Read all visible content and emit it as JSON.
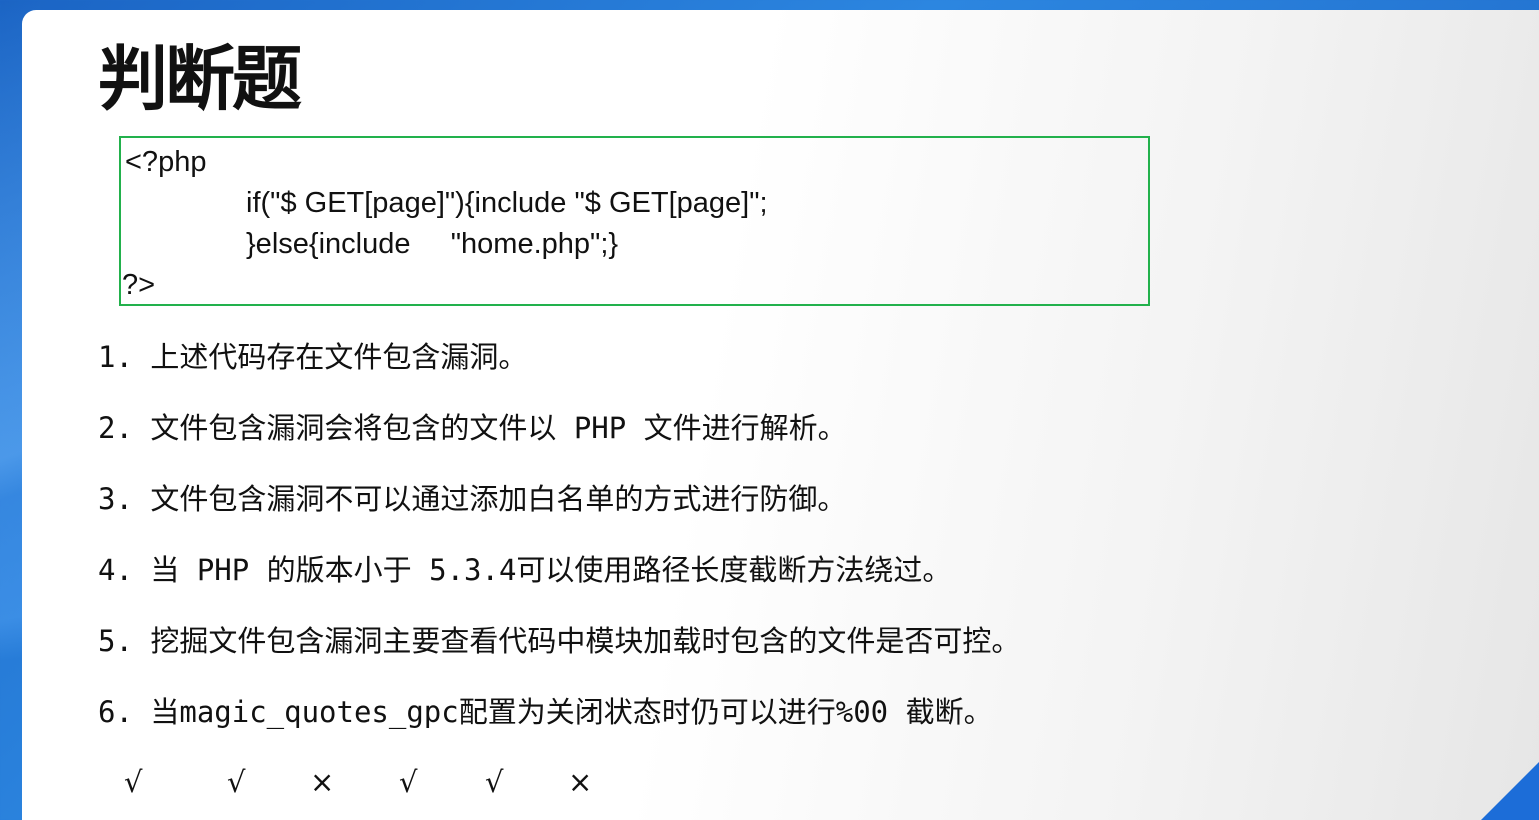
{
  "slide": {
    "title": "判断题",
    "code": {
      "line1": "<?php",
      "line2": "if(\"$ GET[page]\"){include \"$ GET[page]\";",
      "line3": "}else{include     \"home.php\";}",
      "line4": "?>"
    },
    "questions": [
      "1. 上述代码存在文件包含漏洞。",
      "2. 文件包含漏洞会将包含的文件以 PHP 文件进行解析。",
      "3. 文件包含漏洞不可以通过添加白名单的方式进行防御。",
      "4. 当 PHP 的版本小于 5.3.4可以使用路径长度截断方法绕过。",
      "5. 挖掘文件包含漏洞主要查看代码中模块加载时包含的文件是否可控。",
      "6. 当magic_quotes_gpc配置为关闭状态时仍可以进行%00 截断。"
    ],
    "answers": [
      "√",
      "√",
      "×",
      "√",
      "√",
      "×"
    ]
  },
  "colors": {
    "code_box_border": "#22b14c",
    "background_accent": "#1c6dd8"
  }
}
